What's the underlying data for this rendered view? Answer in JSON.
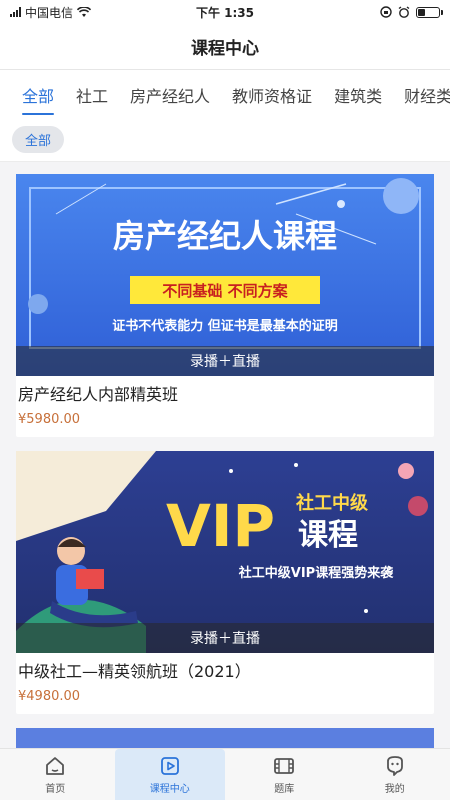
{
  "status_bar": {
    "carrier": "中国电信",
    "time": "下午 1:35"
  },
  "header": {
    "title": "课程中心"
  },
  "tabs": [
    {
      "label": "全部",
      "active": true
    },
    {
      "label": "社工",
      "active": false
    },
    {
      "label": "房产经纪人",
      "active": false
    },
    {
      "label": "教师资格证",
      "active": false
    },
    {
      "label": "建筑类",
      "active": false
    },
    {
      "label": "财经类",
      "active": false
    }
  ],
  "filter": {
    "chip_label": "全部"
  },
  "courses": [
    {
      "banner": {
        "headline": "房产经纪人课程",
        "tagline": "不同基础 不同方案",
        "slogan": "证书不代表能力 但证书是最基本的证明",
        "caption": "录播＋直播"
      },
      "title": "房产经纪人内部精英班",
      "price": "¥5980.00"
    },
    {
      "banner": {
        "big": "VIP",
        "sub1": "社工中级",
        "sub2": "课程",
        "slogan": "社工中级VIP课程强势来袭",
        "caption": "录播＋直播"
      },
      "title": "中级社工—精英领航班（2021）",
      "price": "¥4980.00"
    }
  ],
  "bottom_nav": [
    {
      "label": "首页",
      "icon": "home-icon",
      "active": false
    },
    {
      "label": "课程中心",
      "icon": "play-icon",
      "active": true
    },
    {
      "label": "题库",
      "icon": "film-icon",
      "active": false
    },
    {
      "label": "我的",
      "icon": "profile-icon",
      "active": false
    }
  ],
  "colors": {
    "accent": "#2b73d9",
    "price": "#c7703a",
    "banner1_bg": "#3a6fe0",
    "banner2_bg": "#2a3a8a"
  }
}
